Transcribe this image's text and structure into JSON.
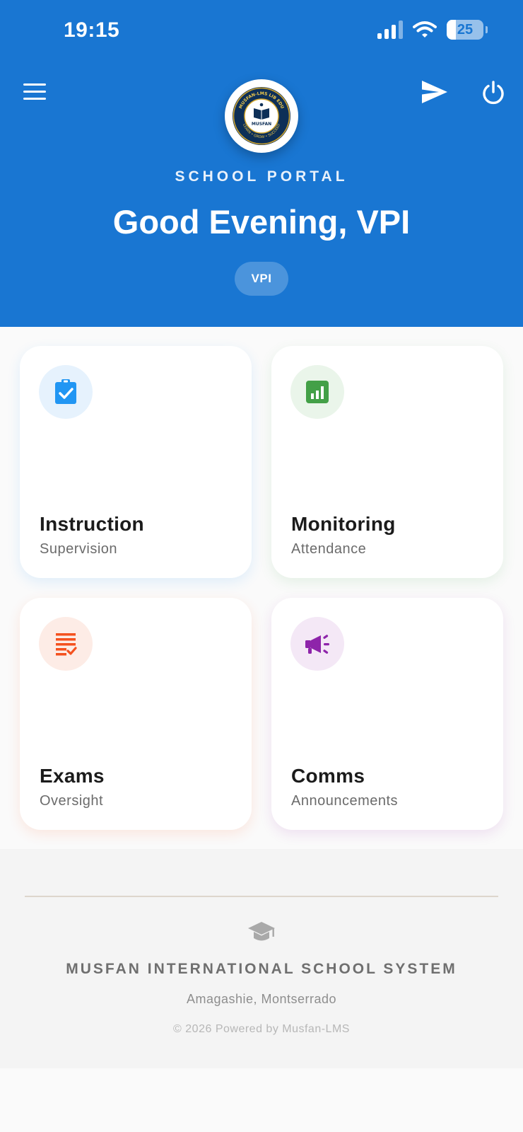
{
  "status_bar": {
    "time": "19:15",
    "battery": "25",
    "battery_level": 0.25,
    "signal_bars": 3,
    "signal_bars_total": 4
  },
  "header": {
    "portal_label": "SCHOOL PORTAL",
    "greeting": "Good Evening, VPI",
    "role_badge": "VPI",
    "logo": {
      "top_text": "MUSFAN-LMS LIB EDU",
      "inner_text": "MUSFAN",
      "bottom_text": "LEARN • GROW • SUCCEED"
    }
  },
  "cards": [
    {
      "title": "Instruction",
      "subtitle": "Supervision",
      "icon": "clipboard-check-icon",
      "color": "#2196f3",
      "bg": "#e6f2fd"
    },
    {
      "title": "Monitoring",
      "subtitle": "Attendance",
      "icon": "bar-chart-icon",
      "color": "#43a047",
      "bg": "#eaf5ea"
    },
    {
      "title": "Exams",
      "subtitle": "Oversight",
      "icon": "checklist-icon",
      "color": "#f4511e",
      "bg": "#fdece6"
    },
    {
      "title": "Comms",
      "subtitle": "Announcements",
      "icon": "megaphone-icon",
      "color": "#8e24aa",
      "bg": "#f4e8f6"
    }
  ],
  "footer": {
    "org_name": "MUSFAN INTERNATIONAL SCHOOL SYSTEM",
    "location": "Amagashie, Montserrado",
    "copyright": "© 2026 Powered by Musfan-LMS"
  },
  "colors": {
    "header_bg": "#1976d2",
    "page_bg": "#fafafa",
    "footer_bg": "#f4f4f4"
  }
}
